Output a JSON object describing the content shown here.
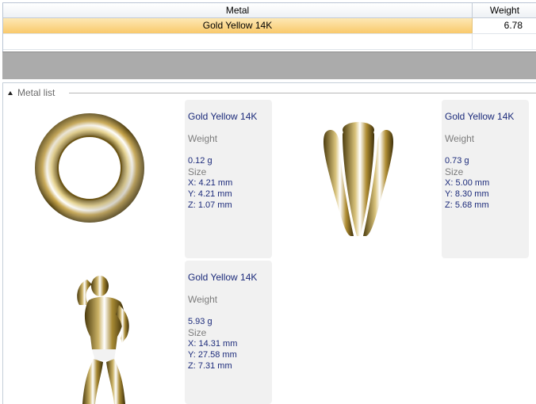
{
  "grid": {
    "columns": [
      "Metal",
      "Weight"
    ],
    "rows": [
      {
        "metal": "Gold Yellow 14K",
        "weight": "6.78"
      }
    ]
  },
  "panel": {
    "title": "Metal list"
  },
  "items": [
    {
      "name": "Gold Yellow 14K",
      "weight_label": "Weight",
      "weight": "0.12 g",
      "size_label": "Size",
      "x": "X: 4.21 mm",
      "y": "Y: 4.21 mm",
      "z": "Z: 1.07 mm"
    },
    {
      "name": "Gold Yellow 14K",
      "weight_label": "Weight",
      "weight": "0.73 g",
      "size_label": "Size",
      "x": "X: 5.00 mm",
      "y": "Y: 8.30 mm",
      "z": "Z: 5.68 mm"
    },
    {
      "name": "Gold Yellow 14K",
      "weight_label": "Weight",
      "weight": "5.93 g",
      "size_label": "Size",
      "x": "X: 14.31 mm",
      "y": "Y: 27.58 mm",
      "z": "Z: 7.31 mm"
    }
  ],
  "colors": {
    "selection": "#f9c96b",
    "value_text": "#1b2a7a",
    "label_text": "#7d7d7d",
    "gold": "#b89a3e"
  }
}
